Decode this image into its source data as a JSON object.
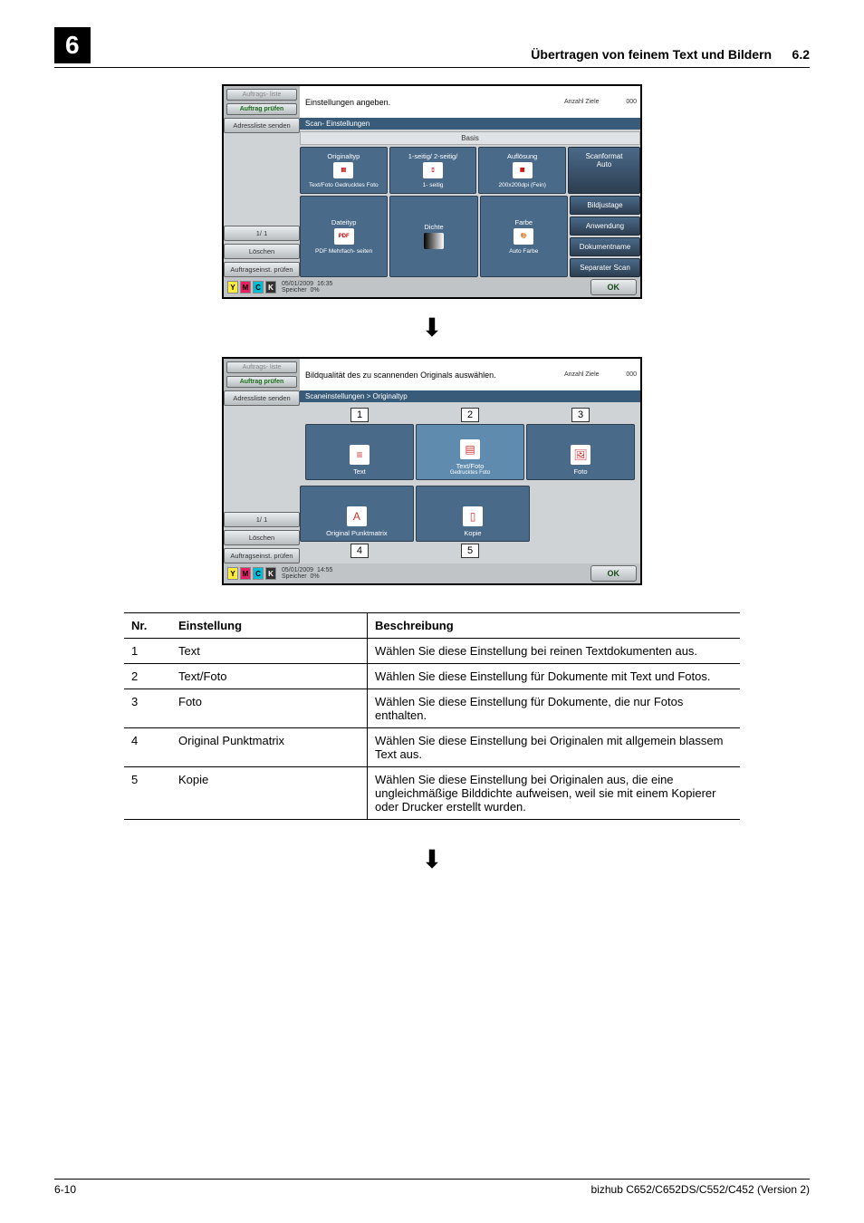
{
  "header": {
    "chapter": "6",
    "title": "Übertragen von feinem Text und Bildern",
    "section": "6.2"
  },
  "screen1": {
    "tabs": {
      "auftragsliste": "Auftrags-\nliste",
      "auftragpruefen": "Auftrag\nprüfen"
    },
    "prompt": "Einstellungen angeben.",
    "count_label": "Anzahl\nZiele",
    "count_value": "000",
    "subheader": "Scan-\nEinstellungen",
    "basis": "Basis",
    "side": {
      "adressliste": "Adressliste senden",
      "pager": "1/  1",
      "loeschen": "Löschen",
      "auftragseinst": "Auftragseinst.\nprüfen"
    },
    "grid": {
      "r1c1_top": "Originaltyp",
      "r1c1_bot": "Text/Foto\nGedrucktes\nFoto",
      "r1c2_top": "1-seitig/\n2-seitig/",
      "r1c2_bot": "1-\nseitig",
      "r1c3_top": "Auflösung",
      "r1c3_bot": "200x200dpi\n(Fein)",
      "r2c1_top": "Dateityp",
      "r2c1_bot": "PDF\nMehrfach-\nseiten",
      "r2c1_badge": "PDF",
      "r2c2_top": "Dichte",
      "r2c3_top": "Farbe",
      "r2c3_bot": "Auto Farbe"
    },
    "right": {
      "scanformat": "Scanformat",
      "auto": "Auto",
      "bildjustage": "Bildjustage",
      "anwendung": "Anwendung",
      "dokumentname": "Dokumentname",
      "separaterscan": "Separater Scan"
    },
    "status": {
      "date": "05/01/2009",
      "time": "16:35",
      "mem": "Speicher",
      "pct": "0%"
    },
    "ok": "OK"
  },
  "screen2": {
    "prompt": "Bildqualität des zu scannenden Originals auswählen.",
    "subheader": "Scaneinstellungen > Originaltyp",
    "options": {
      "o1": {
        "num": "1",
        "label": "Text"
      },
      "o2": {
        "num": "2",
        "label": "Text/Foto",
        "sub": "Gedrucktes\nFoto"
      },
      "o3": {
        "num": "3",
        "label": "Foto"
      },
      "o4": {
        "num": "4",
        "label": "Original Punktmatrix"
      },
      "o5": {
        "num": "5",
        "label": "Kopie"
      }
    },
    "status": {
      "date": "05/01/2009",
      "time": "14:55",
      "mem": "Speicher",
      "pct": "0%"
    },
    "ok": "OK"
  },
  "table": {
    "headers": {
      "nr": "Nr.",
      "setting": "Einstellung",
      "desc": "Beschreibung"
    },
    "rows": [
      {
        "nr": "1",
        "setting": "Text",
        "desc": "Wählen Sie diese Einstellung bei reinen Textdokumenten aus."
      },
      {
        "nr": "2",
        "setting": "Text/Foto",
        "desc": "Wählen Sie diese Einstellung für Dokumente mit Text und Fotos."
      },
      {
        "nr": "3",
        "setting": "Foto",
        "desc": "Wählen Sie diese Einstellung für Dokumente, die nur Fotos enthalten."
      },
      {
        "nr": "4",
        "setting": "Original Punktmatrix",
        "desc": "Wählen Sie diese Einstellung bei Originalen mit allgemein blassem Text aus."
      },
      {
        "nr": "5",
        "setting": "Kopie",
        "desc": "Wählen Sie diese Einstellung bei Originalen aus, die eine ungleichmäßige Bilddichte aufweisen, weil sie mit einem Kopierer oder Drucker erstellt wurden."
      }
    ]
  },
  "footer": {
    "page": "6-10",
    "product": "bizhub C652/C652DS/C552/C452 (Version 2)"
  },
  "toner": {
    "y": "Y",
    "m": "M",
    "c": "C",
    "k": "K"
  }
}
